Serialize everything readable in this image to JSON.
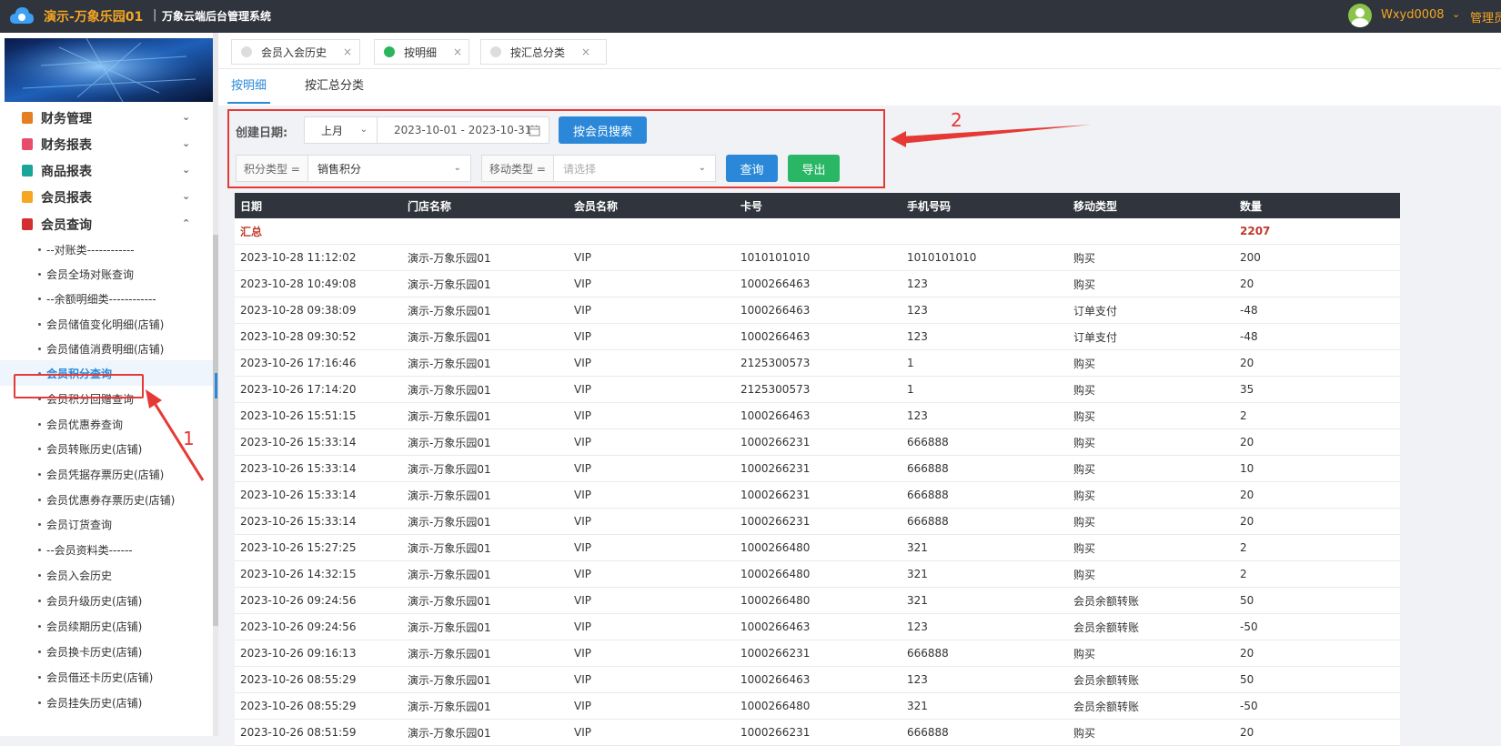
{
  "topbar": {
    "store_name": "演示-万象乐园01",
    "separator": "|",
    "system_name": "万象云端后台管理系统",
    "username": "Wxyd0008",
    "admin_link": "管理员"
  },
  "sidebar": {
    "menus": [
      {
        "label": "财务管理",
        "icon_color": "#e67e22"
      },
      {
        "label": "财务报表",
        "icon_color": "#e74c6c"
      },
      {
        "label": "商品报表",
        "icon_color": "#1aa59a"
      },
      {
        "label": "会员报表",
        "icon_color": "#f5a623"
      },
      {
        "label": "会员查询",
        "icon_color": "#d32f2f"
      }
    ],
    "sub_items": [
      {
        "label": "--对账类------------"
      },
      {
        "label": "会员全场对账查询"
      },
      {
        "label": "--余额明细类------------"
      },
      {
        "label": "会员储值变化明细(店铺)"
      },
      {
        "label": "会员储值消费明细(店铺)"
      },
      {
        "label": "会员积分查询"
      },
      {
        "label": "会员积分回赠查询"
      },
      {
        "label": "会员优惠券查询"
      },
      {
        "label": "会员转账历史(店铺)"
      },
      {
        "label": "会员凭据存票历史(店铺)"
      },
      {
        "label": "会员优惠券存票历史(店铺)"
      },
      {
        "label": "会员订货查询"
      },
      {
        "label": "--会员资料类------"
      },
      {
        "label": "会员入会历史"
      },
      {
        "label": "会员升级历史(店铺)"
      },
      {
        "label": "会员续期历史(店铺)"
      },
      {
        "label": "会员换卡历史(店铺)"
      },
      {
        "label": "会员借还卡历史(店铺)"
      },
      {
        "label": "会员挂失历史(店铺)"
      }
    ],
    "active_item": "会员积分查询"
  },
  "page_tabs": [
    {
      "label": "会员入会历史",
      "active": false
    },
    {
      "label": "按明细",
      "active": true
    },
    {
      "label": "按汇总分类",
      "active": false
    }
  ],
  "close_glyph": "×",
  "sub_tabs": [
    {
      "label": "按明细",
      "active": true
    },
    {
      "label": "按汇总分类",
      "active": false
    }
  ],
  "filters": {
    "date_label": "创建日期:",
    "period_value": "上月",
    "date_range": "2023-10-01 - 2023-10-31",
    "search_member_button": "按会员搜索",
    "points_type_label": "积分类型 =",
    "points_type_value": "销售积分",
    "move_type_label": "移动类型 =",
    "move_type_placeholder": "请选择",
    "query_button": "查询",
    "export_button": "导出"
  },
  "annotations": {
    "one": "1",
    "two": "2"
  },
  "table": {
    "headers": [
      "日期",
      "门店名称",
      "会员名称",
      "卡号",
      "手机号码",
      "移动类型",
      "数量"
    ],
    "total": {
      "label": "汇总",
      "quantity": "2207"
    },
    "rows": [
      [
        "2023-10-28 11:12:02",
        "演示-万象乐园01",
        "VIP",
        "1010101010",
        "1010101010",
        "购买",
        "200"
      ],
      [
        "2023-10-28 10:49:08",
        "演示-万象乐园01",
        "VIP",
        "1000266463",
        "123",
        "购买",
        "20"
      ],
      [
        "2023-10-28 09:38:09",
        "演示-万象乐园01",
        "VIP",
        "1000266463",
        "123",
        "订单支付",
        "-48"
      ],
      [
        "2023-10-28 09:30:52",
        "演示-万象乐园01",
        "VIP",
        "1000266463",
        "123",
        "订单支付",
        "-48"
      ],
      [
        "2023-10-26 17:16:46",
        "演示-万象乐园01",
        "VIP",
        "2125300573",
        "1",
        "购买",
        "20"
      ],
      [
        "2023-10-26 17:14:20",
        "演示-万象乐园01",
        "VIP",
        "2125300573",
        "1",
        "购买",
        "35"
      ],
      [
        "2023-10-26 15:51:15",
        "演示-万象乐园01",
        "VIP",
        "1000266463",
        "123",
        "购买",
        "2"
      ],
      [
        "2023-10-26 15:33:14",
        "演示-万象乐园01",
        "VIP",
        "1000266231",
        "666888",
        "购买",
        "20"
      ],
      [
        "2023-10-26 15:33:14",
        "演示-万象乐园01",
        "VIP",
        "1000266231",
        "666888",
        "购买",
        "10"
      ],
      [
        "2023-10-26 15:33:14",
        "演示-万象乐园01",
        "VIP",
        "1000266231",
        "666888",
        "购买",
        "20"
      ],
      [
        "2023-10-26 15:33:14",
        "演示-万象乐园01",
        "VIP",
        "1000266231",
        "666888",
        "购买",
        "20"
      ],
      [
        "2023-10-26 15:27:25",
        "演示-万象乐园01",
        "VIP",
        "1000266480",
        "321",
        "购买",
        "2"
      ],
      [
        "2023-10-26 14:32:15",
        "演示-万象乐园01",
        "VIP",
        "1000266480",
        "321",
        "购买",
        "2"
      ],
      [
        "2023-10-26 09:24:56",
        "演示-万象乐园01",
        "VIP",
        "1000266480",
        "321",
        "会员余额转账",
        "50"
      ],
      [
        "2023-10-26 09:24:56",
        "演示-万象乐园01",
        "VIP",
        "1000266463",
        "123",
        "会员余额转账",
        "-50"
      ],
      [
        "2023-10-26 09:16:13",
        "演示-万象乐园01",
        "VIP",
        "1000266231",
        "666888",
        "购买",
        "20"
      ],
      [
        "2023-10-26 08:55:29",
        "演示-万象乐园01",
        "VIP",
        "1000266463",
        "123",
        "会员余额转账",
        "50"
      ],
      [
        "2023-10-26 08:55:29",
        "演示-万象乐园01",
        "VIP",
        "1000266480",
        "321",
        "会员余额转账",
        "-50"
      ],
      [
        "2023-10-26 08:51:59",
        "演示-万象乐园01",
        "VIP",
        "1000266231",
        "666888",
        "购买",
        "20"
      ]
    ]
  }
}
